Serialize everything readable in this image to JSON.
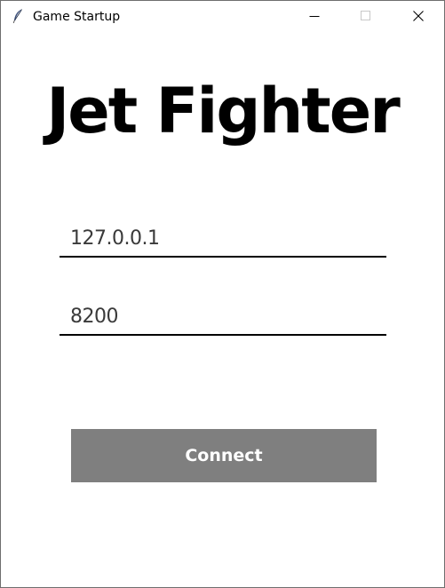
{
  "window": {
    "title": "Game Startup",
    "app_icon": "feather-icon",
    "controls": {
      "minimize": "minimize-icon",
      "maximize": "maximize-icon",
      "close": "close-icon"
    }
  },
  "main": {
    "heading": "Jet Fighter",
    "host_field": {
      "value": "127.0.0.1"
    },
    "port_field": {
      "value": "8200"
    },
    "connect_label": "Connect"
  },
  "colors": {
    "button_bg": "#7f7f7f",
    "button_text": "#ffffff",
    "underline": "#000000"
  }
}
